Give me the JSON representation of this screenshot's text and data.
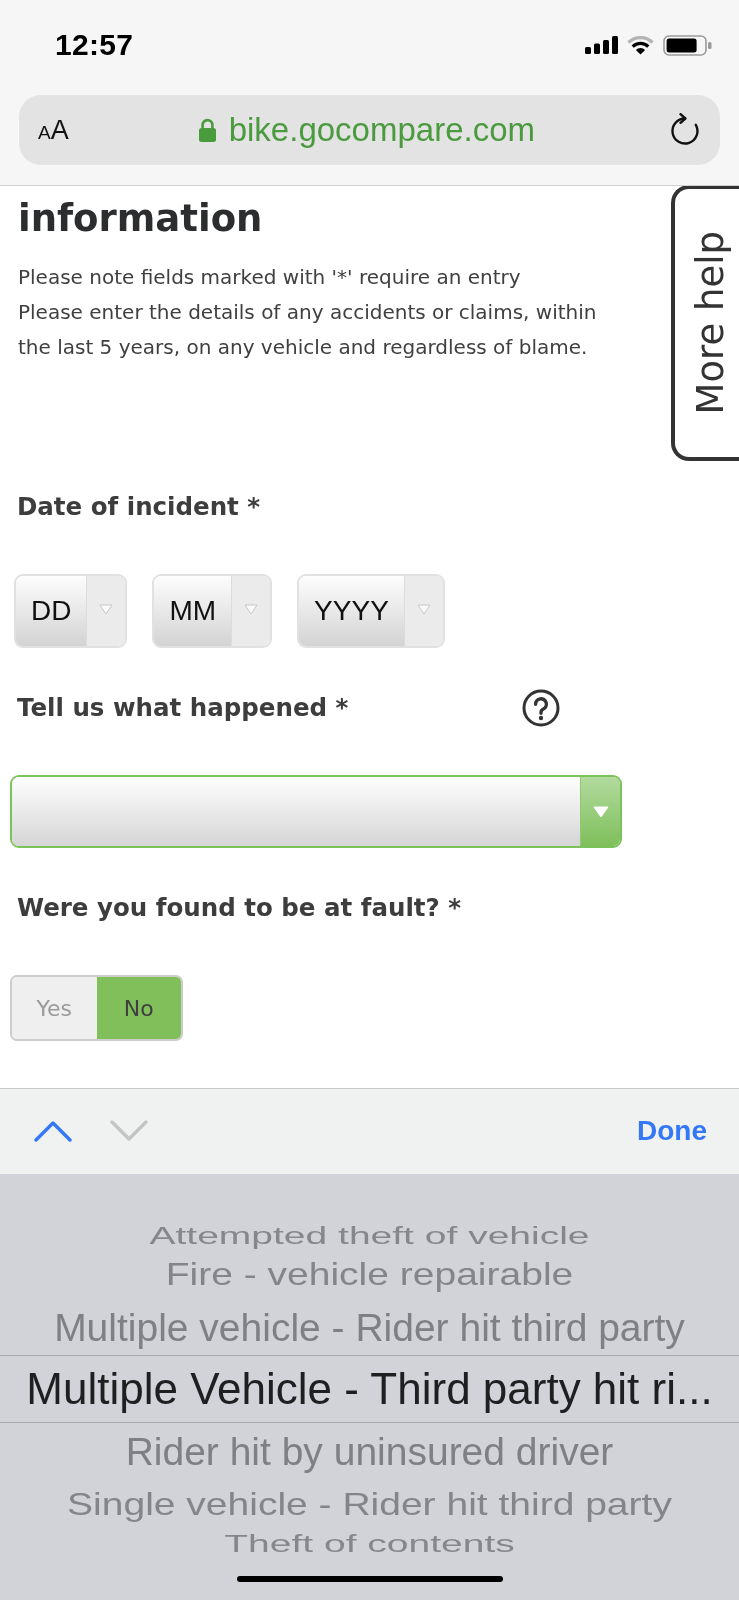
{
  "status_bar": {
    "time": "12:57"
  },
  "browser": {
    "text_size_button": "AA",
    "secure": true,
    "url": "bike.gocompare.com"
  },
  "page": {
    "heading": "information",
    "notes": [
      "Please note fields marked with '*' require an entry",
      "Please enter the details of any accidents or claims, within the last 5 years, on any vehicle and regardless of blame."
    ],
    "help_tab": "More help",
    "fields": [
      {
        "kind": "date",
        "label": "Date of incident *",
        "selects": [
          {
            "value": "DD"
          },
          {
            "value": "MM"
          },
          {
            "value": "YYYY"
          }
        ]
      },
      {
        "kind": "select",
        "label": "Tell us what happened *",
        "help": true,
        "focused": true
      },
      {
        "kind": "toggle",
        "label": "Were you found to be at fault? *",
        "options": [
          {
            "label": "Yes",
            "selected": false
          },
          {
            "label": "No",
            "selected": true
          }
        ]
      }
    ]
  },
  "toolbar": {
    "previous": {
      "disabled": false
    },
    "next": {
      "disabled": true
    },
    "done": "Done"
  },
  "picker": {
    "options": [
      {
        "label": "Attempted theft of vehicle",
        "selected": false
      },
      {
        "label": "Fire - vehicle repairable",
        "selected": false
      },
      {
        "label": "Multiple vehicle - Rider hit third party",
        "selected": false
      },
      {
        "label": "Multiple Vehicle - Third party hit ri...",
        "selected": true
      },
      {
        "label": "Rider hit by uninsured driver",
        "selected": false
      },
      {
        "label": "Single vehicle - Rider hit third party",
        "selected": false
      },
      {
        "label": "Theft of contents",
        "selected": false
      }
    ]
  }
}
